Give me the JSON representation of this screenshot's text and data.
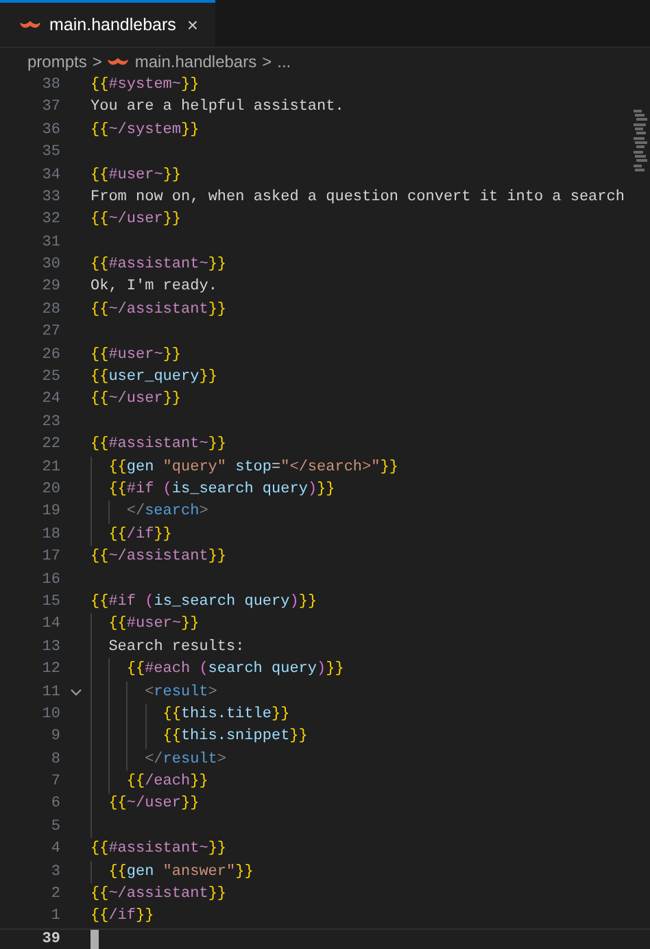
{
  "tab": {
    "label": "main.handlebars",
    "close": "×",
    "selected": true
  },
  "breadcrumb": {
    "folder": "prompts",
    "separator_1": ">",
    "file": "main.handlebars",
    "separator_2": ">",
    "more": "..."
  },
  "lines": [
    {
      "number": "38",
      "tokens": [
        {
          "kind": "brace",
          "text": "{{"
        },
        {
          "kind": "block",
          "text": "#system~"
        },
        {
          "kind": "brace",
          "text": "}}"
        }
      ]
    },
    {
      "number": "37",
      "tokens": [
        {
          "kind": "text",
          "text": "You are a helpful assistant."
        }
      ]
    },
    {
      "number": "36",
      "tokens": [
        {
          "kind": "brace",
          "text": "{{"
        },
        {
          "kind": "block",
          "text": "~/system"
        },
        {
          "kind": "brace",
          "text": "}}"
        }
      ]
    },
    {
      "number": "35"
    },
    {
      "number": "34",
      "tokens": [
        {
          "kind": "brace",
          "text": "{{"
        },
        {
          "kind": "block",
          "text": "#user~"
        },
        {
          "kind": "brace",
          "text": "}}"
        }
      ]
    },
    {
      "number": "33",
      "tokens": [
        {
          "kind": "text",
          "text": "From now on, when asked a question convert it into a search"
        }
      ]
    },
    {
      "number": "32",
      "tokens": [
        {
          "kind": "brace",
          "text": "{{"
        },
        {
          "kind": "block",
          "text": "~/user"
        },
        {
          "kind": "brace",
          "text": "}}"
        }
      ]
    },
    {
      "number": "31"
    },
    {
      "number": "30",
      "tokens": [
        {
          "kind": "brace",
          "text": "{{"
        },
        {
          "kind": "block",
          "text": "#assistant~"
        },
        {
          "kind": "brace",
          "text": "}}"
        }
      ]
    },
    {
      "number": "29",
      "tokens": [
        {
          "kind": "text",
          "text": "Ok, I'm ready."
        }
      ]
    },
    {
      "number": "28",
      "tokens": [
        {
          "kind": "brace",
          "text": "{{"
        },
        {
          "kind": "block",
          "text": "~/assistant"
        },
        {
          "kind": "brace",
          "text": "}}"
        }
      ]
    },
    {
      "number": "27"
    },
    {
      "number": "26",
      "tokens": [
        {
          "kind": "brace",
          "text": "{{"
        },
        {
          "kind": "block",
          "text": "#user~"
        },
        {
          "kind": "brace",
          "text": "}}"
        }
      ]
    },
    {
      "number": "25",
      "tokens": [
        {
          "kind": "brace",
          "text": "{{"
        },
        {
          "kind": "variable",
          "text": "user_query"
        },
        {
          "kind": "brace",
          "text": "}}"
        }
      ]
    },
    {
      "number": "24",
      "tokens": [
        {
          "kind": "brace",
          "text": "{{"
        },
        {
          "kind": "block",
          "text": "~/user"
        },
        {
          "kind": "brace",
          "text": "}}"
        }
      ]
    },
    {
      "number": "23"
    },
    {
      "number": "22",
      "tokens": [
        {
          "kind": "brace",
          "text": "{{"
        },
        {
          "kind": "block",
          "text": "#assistant~"
        },
        {
          "kind": "brace",
          "text": "}}"
        }
      ],
      "children": [
        {
          "number": "21",
          "tokens": [
            {
              "kind": "brace",
              "text": "{{"
            },
            {
              "kind": "variable",
              "text": "gen "
            },
            {
              "kind": "string",
              "text": "\"query\" "
            },
            {
              "kind": "variable",
              "text": "stop"
            },
            {
              "kind": "text",
              "text": "="
            },
            {
              "kind": "string",
              "text": "\"</search>\""
            },
            {
              "kind": "brace",
              "text": "}}"
            }
          ]
        },
        {
          "number": "20",
          "tokens": [
            {
              "kind": "brace",
              "text": "{{"
            },
            {
              "kind": "block",
              "text": "#if "
            },
            {
              "kind": "paren",
              "text": "("
            },
            {
              "kind": "variable",
              "text": "is_search query"
            },
            {
              "kind": "paren",
              "text": ")"
            },
            {
              "kind": "brace",
              "text": "}}"
            }
          ],
          "children": [
            {
              "number": "19",
              "tokens": [
                {
                  "kind": "tag_bracket",
                  "text": "</"
                },
                {
                  "kind": "tag_name",
                  "text": "search"
                },
                {
                  "kind": "tag_bracket",
                  "text": ">"
                }
              ]
            }
          ]
        },
        {
          "number": "18",
          "tokens": [
            {
              "kind": "brace",
              "text": "{{"
            },
            {
              "kind": "block",
              "text": "/if"
            },
            {
              "kind": "brace",
              "text": "}}"
            }
          ]
        }
      ]
    },
    {
      "number": "17",
      "tokens": [
        {
          "kind": "brace",
          "text": "{{"
        },
        {
          "kind": "block",
          "text": "~/assistant"
        },
        {
          "kind": "brace",
          "text": "}}"
        }
      ]
    },
    {
      "number": "16"
    },
    {
      "number": "15",
      "tokens": [
        {
          "kind": "brace",
          "text": "{{"
        },
        {
          "kind": "block",
          "text": "#if "
        },
        {
          "kind": "paren",
          "text": "("
        },
        {
          "kind": "variable",
          "text": "is_search query"
        },
        {
          "kind": "paren",
          "text": ")"
        },
        {
          "kind": "brace",
          "text": "}}"
        }
      ],
      "children": [
        {
          "number": "14",
          "tokens": [
            {
              "kind": "brace",
              "text": "{{"
            },
            {
              "kind": "block",
              "text": "#user~"
            },
            {
              "kind": "brace",
              "text": "}}"
            }
          ]
        },
        {
          "number": "13",
          "tokens": [
            {
              "kind": "text",
              "text": "Search results:"
            }
          ],
          "children": [
            {
              "number": "12",
              "tokens": [
                {
                  "kind": "brace",
                  "text": "{{"
                },
                {
                  "kind": "block",
                  "text": "#each "
                },
                {
                  "kind": "paren",
                  "text": "("
                },
                {
                  "kind": "variable",
                  "text": "search query"
                },
                {
                  "kind": "paren",
                  "text": ")"
                },
                {
                  "kind": "brace",
                  "text": "}}"
                }
              ],
              "children": [
                {
                  "number": "11",
                  "expanded": true,
                  "tokens": [
                    {
                      "kind": "tag_bracket",
                      "text": "<"
                    },
                    {
                      "kind": "tag_name",
                      "text": "result"
                    },
                    {
                      "kind": "tag_bracket",
                      "text": ">"
                    }
                  ],
                  "children": [
                    {
                      "number": "10",
                      "tokens": [
                        {
                          "kind": "brace",
                          "text": "{{"
                        },
                        {
                          "kind": "variable",
                          "text": "this.title"
                        },
                        {
                          "kind": "brace",
                          "text": "}}"
                        }
                      ]
                    },
                    {
                      "number": "9",
                      "tokens": [
                        {
                          "kind": "brace",
                          "text": "{{"
                        },
                        {
                          "kind": "variable",
                          "text": "this.snippet"
                        },
                        {
                          "kind": "brace",
                          "text": "}}"
                        }
                      ]
                    }
                  ]
                },
                {
                  "number": "8",
                  "tokens": [
                    {
                      "kind": "tag_bracket",
                      "text": "</"
                    },
                    {
                      "kind": "tag_name",
                      "text": "result"
                    },
                    {
                      "kind": "tag_bracket",
                      "text": ">"
                    }
                  ]
                }
              ]
            },
            {
              "number": "7",
              "tokens": [
                {
                  "kind": "brace",
                  "text": "{{"
                },
                {
                  "kind": "block",
                  "text": "/each"
                },
                {
                  "kind": "brace",
                  "text": "}}"
                }
              ]
            }
          ]
        },
        {
          "number": "6",
          "tokens": [
            {
              "kind": "brace",
              "text": "{{"
            },
            {
              "kind": "block",
              "text": "~/user"
            },
            {
              "kind": "brace",
              "text": "}}"
            }
          ]
        },
        {
          "number": "5"
        }
      ]
    },
    {
      "number": "4",
      "tokens": [
        {
          "kind": "brace",
          "text": "{{"
        },
        {
          "kind": "block",
          "text": "#assistant~"
        },
        {
          "kind": "brace",
          "text": "}}"
        }
      ],
      "children": [
        {
          "number": "3",
          "tokens": [
            {
              "kind": "brace",
              "text": "{{"
            },
            {
              "kind": "variable",
              "text": "gen "
            },
            {
              "kind": "string",
              "text": "\"answer\""
            },
            {
              "kind": "brace",
              "text": "}}"
            }
          ]
        }
      ]
    },
    {
      "number": "2",
      "tokens": [
        {
          "kind": "brace",
          "text": "{{"
        },
        {
          "kind": "block",
          "text": "~/assistant"
        },
        {
          "kind": "brace",
          "text": "}}"
        }
      ]
    },
    {
      "number": "1",
      "tokens": [
        {
          "kind": "brace",
          "text": "{{"
        },
        {
          "kind": "block",
          "text": "/if"
        },
        {
          "kind": "brace",
          "text": "}}"
        }
      ]
    },
    {
      "number": "39",
      "current": true
    }
  ]
}
